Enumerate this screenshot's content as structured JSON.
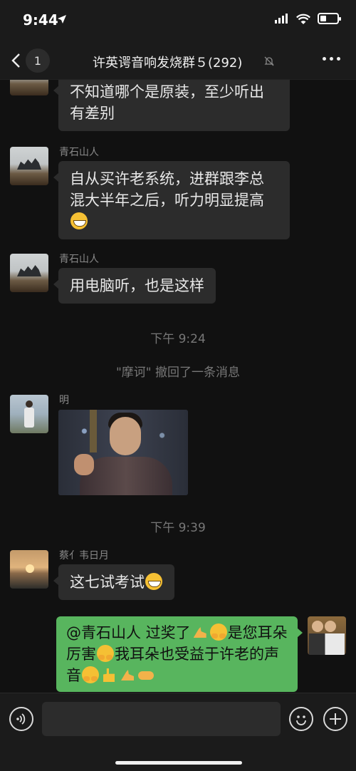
{
  "status_bar": {
    "time": "9:44",
    "battery_level": 0.3
  },
  "nav": {
    "unread_count": "1",
    "title": "许英谔音响发烧群５(292)"
  },
  "messages": [
    {
      "sender": "",
      "text": "不知道哪个是原装，至少听出有差别"
    },
    {
      "sender": "青石山人",
      "text": "自从买许老系统，进群跟李总混大半年之后，听力明显提高"
    },
    {
      "sender": "青石山人",
      "text": "用电脑听，也是这样"
    },
    {
      "sender": "明"
    },
    {
      "sender": "蔡亻韦日月",
      "text": "这七试考试"
    },
    {
      "sender": "",
      "text": "@青石山人 过奖了",
      "text2": "是您耳朵厉害",
      "text3": "我耳朵也受益于许老的声音"
    }
  ],
  "system": {
    "time1": "下午 9:24",
    "recall": "\"摩诃\" 撤回了一条消息",
    "time2": "下午 9:39"
  },
  "icons": {
    "back": "chevron-left-icon",
    "mute": "bell-slash-icon",
    "more": "ellipsis-icon",
    "voice": "voice-icon",
    "emoji": "smiley-icon",
    "plus": "plus-icon"
  },
  "colors": {
    "bubble_mine": "#58b55e",
    "bubble_other": "#2c2c2c",
    "background": "#111111"
  }
}
